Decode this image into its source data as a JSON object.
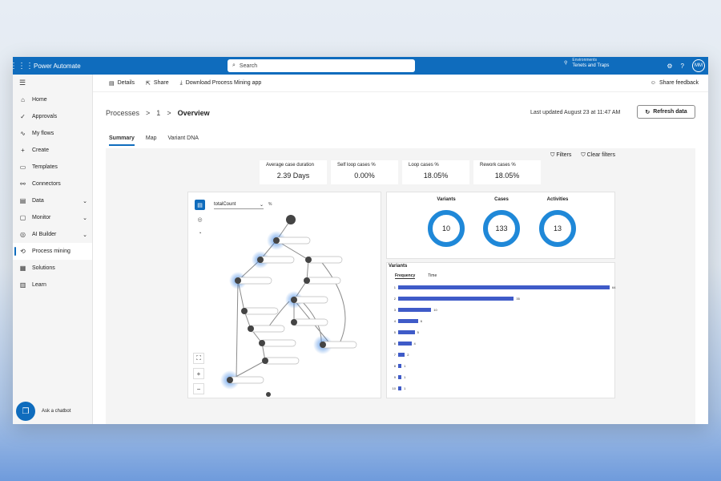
{
  "app": {
    "title": "Power Automate",
    "search_placeholder": "Search",
    "env_label": "Environments",
    "env_name": "Tenets and Traps",
    "avatar": "MM"
  },
  "sidebar": {
    "items": [
      {
        "label": "Home",
        "icon": "⌂"
      },
      {
        "label": "Approvals",
        "icon": "✓"
      },
      {
        "label": "My flows",
        "icon": "∿"
      },
      {
        "label": "Create",
        "icon": "+"
      },
      {
        "label": "Templates",
        "icon": "▭"
      },
      {
        "label": "Connectors",
        "icon": "⚯"
      },
      {
        "label": "Data",
        "icon": "▤",
        "chev": "⌄"
      },
      {
        "label": "Monitor",
        "icon": "▢",
        "chev": "⌄"
      },
      {
        "label": "AI Builder",
        "icon": "◎",
        "chev": "⌄"
      },
      {
        "label": "Process mining",
        "icon": "⟲"
      },
      {
        "label": "Solutions",
        "icon": "▦"
      },
      {
        "label": "Learn",
        "icon": "▥"
      }
    ],
    "chatbot": "Ask a chatbot"
  },
  "toolbar": {
    "details": "Details",
    "share": "Share",
    "download": "Download Process Mining app",
    "feedback": "Share feedback"
  },
  "breadcrumb": {
    "root": "Processes",
    "sep": ">",
    "num": "1",
    "current": "Overview"
  },
  "last_updated": "Last updated August 23 at 11:47 AM",
  "refresh": "Refresh data",
  "tabs": [
    "Summary",
    "Map",
    "Variant DNA"
  ],
  "filters": {
    "filters": "Filters",
    "clear": "Clear filters"
  },
  "kpis": [
    {
      "label": "Average case duration",
      "value": "2.39 Days"
    },
    {
      "label": "Self loop cases %",
      "value": "0.00%"
    },
    {
      "label": "Loop cases %",
      "value": "18.05%"
    },
    {
      "label": "Rework cases %",
      "value": "18.05%"
    }
  ],
  "map": {
    "dropdown": "totalCount",
    "pct": "%"
  },
  "stats": [
    {
      "label": "Variants",
      "value": "10"
    },
    {
      "label": "Cases",
      "value": "133"
    },
    {
      "label": "Activities",
      "value": "13"
    }
  ],
  "variants": {
    "title": "Variants",
    "tabs": [
      "Frequency",
      "Time"
    ],
    "rows": [
      {
        "n": "1",
        "v": 64
      },
      {
        "n": "2",
        "v": 35
      },
      {
        "n": "3",
        "v": 10
      },
      {
        "n": "4",
        "v": 6
      },
      {
        "n": "5",
        "v": 5
      },
      {
        "n": "6",
        "v": 4
      },
      {
        "n": "7",
        "v": 2
      },
      {
        "n": "8",
        "v": 1
      },
      {
        "n": "9",
        "v": 1
      },
      {
        "n": "10",
        "v": 1
      }
    ]
  },
  "colors": {
    "brand": "#0f6cbd",
    "bar": "#3f5bc8",
    "ring": "#1f88d8"
  }
}
